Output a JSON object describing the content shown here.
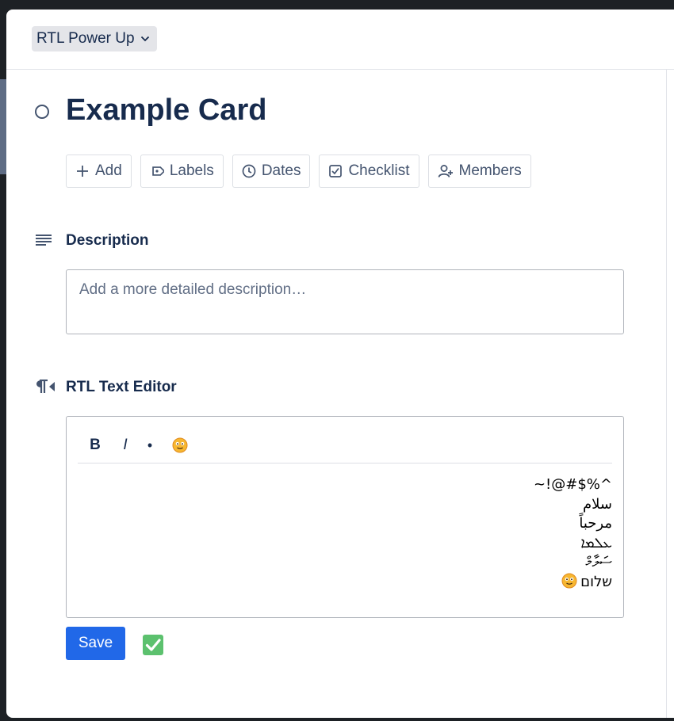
{
  "header": {
    "powerup_label": "RTL Power Up"
  },
  "card": {
    "title": "Example Card"
  },
  "actions": [
    {
      "label": "Add",
      "icon": "plus-icon"
    },
    {
      "label": "Labels",
      "icon": "tag-icon"
    },
    {
      "label": "Dates",
      "icon": "clock-icon"
    },
    {
      "label": "Checklist",
      "icon": "checkbox-icon"
    },
    {
      "label": "Members",
      "icon": "add-person-icon"
    }
  ],
  "description": {
    "title": "Description",
    "placeholder": "Add a more detailed description…"
  },
  "rtl_editor": {
    "title": "RTL Text Editor",
    "toolbar": {
      "bold": "B",
      "italic": "I",
      "bullet": "•",
      "emoji_icon": "smiley-emoji-icon"
    },
    "lines": [
      "~!@#$%^",
      "سلام",
      "مرحباً",
      "ܥܠܡܐ",
      "ސަލާމް",
      "שלום"
    ]
  },
  "footer": {
    "save_label": "Save",
    "check_icon": "green-checkmark-icon"
  },
  "colors": {
    "primary": "#2168e8",
    "text": "#172b4d",
    "muted": "#44546f",
    "check_green": "#3ea65a"
  }
}
